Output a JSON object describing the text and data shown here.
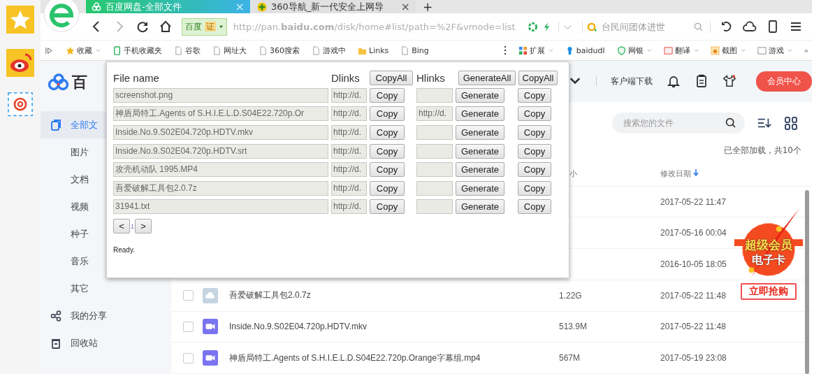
{
  "browser": {
    "tabs": [
      {
        "title": "百度网盘-全部文件",
        "close": "×",
        "selected": true
      },
      {
        "title": "360导航_新一代安全上网导",
        "close": "×",
        "selected": false
      }
    ],
    "new_tab": "+",
    "address": {
      "badge": "百度",
      "cert": "证",
      "url": "http://pan.**baidu.com**/disk/home#list/path=%2F&vmode=list"
    },
    "search": {
      "placeholder": "台民间团体进世"
    },
    "bookmarks": [
      {
        "label": "收藏",
        "kind": "star",
        "dropdown": true
      },
      {
        "label": "手机收藏夹",
        "kind": "phone",
        "dropdown": false
      },
      {
        "label": "谷歌",
        "kind": "page",
        "dropdown": false
      },
      {
        "label": "网址大",
        "kind": "page",
        "dropdown": false
      },
      {
        "label": "360搜索",
        "kind": "page",
        "dropdown": false
      },
      {
        "label": "游戏中",
        "kind": "page",
        "dropdown": false
      },
      {
        "label": "Links",
        "kind": "folder",
        "dropdown": false
      },
      {
        "label": "Bing",
        "kind": "page",
        "dropdown": false
      }
    ],
    "extensions": [
      {
        "label": "扩展",
        "kind": "apps",
        "dropdown": true
      },
      {
        "label": "baidudl",
        "kind": "pin",
        "dropdown": false
      },
      {
        "label": "网银",
        "kind": "shield",
        "dropdown": true
      },
      {
        "label": "翻译",
        "kind": "translate",
        "dropdown": true
      },
      {
        "label": "截图",
        "kind": "crop",
        "dropdown": true
      },
      {
        "label": "游戏",
        "kind": "game",
        "dropdown": true
      }
    ],
    "more": "»"
  },
  "pan": {
    "logo": "百",
    "nav": [
      {
        "label": "全部文",
        "kind": "files",
        "selected": true
      },
      {
        "label": "图片",
        "kind": "sub",
        "selected": false
      },
      {
        "label": "文档",
        "kind": "sub",
        "selected": false
      },
      {
        "label": "视频",
        "kind": "sub",
        "selected": false
      },
      {
        "label": "种子",
        "kind": "sub",
        "selected": false
      },
      {
        "label": "音乐",
        "kind": "sub",
        "selected": false
      },
      {
        "label": "其它",
        "kind": "sub",
        "selected": false
      },
      {
        "label": "我的分享",
        "kind": "share",
        "selected": false
      },
      {
        "label": "回收站",
        "kind": "trash",
        "selected": false
      }
    ],
    "header": {
      "download": "客户端下载",
      "vip": "会员中心"
    },
    "search": {
      "placeholder": "搜索您的文件"
    },
    "loaded": "已全部加载，共10个",
    "columns": {
      "size": "小",
      "date": "修改日期"
    },
    "rows": [
      {
        "date": "2017-05-22 11:47"
      },
      {
        "date": "2017-05-16 00:04"
      },
      {
        "date": "2016-10-05 18:05"
      },
      {
        "name": "吾爱破解工具包2.0.7z",
        "kind": "archive",
        "size": "1.22G",
        "date": "2017-05-22 11:48",
        "checked": false
      },
      {
        "name": "Inside.No.9.S02E04.720p.HDTV.mkv",
        "kind": "video",
        "size": "513.9M",
        "date": "2017-05-22 11:48",
        "checked": false
      },
      {
        "name": "神盾局特工.Agents of S.H.I.E.L.D.S04E22.720p.Orange字幕组.mp4",
        "kind": "video",
        "size": "567M",
        "date": "2017-05-19 23:08",
        "checked": false
      }
    ],
    "promo": {
      "title": "超级会员",
      "subtitle": "电子卡",
      "button": "立即抢购"
    }
  },
  "popup": {
    "headers": {
      "file": "File name",
      "dlinks": "Dlinks",
      "copy_all_d": "CopyAll",
      "hlinks": "Hlinks",
      "generate_all": "GenerateAll",
      "copy_all_h": "CopyAll"
    },
    "rows": [
      {
        "file": "screenshot.png",
        "dlink": "http://d.",
        "copy": "Copy",
        "generate": "Generate",
        "copy_h": "Copy"
      },
      {
        "file": "神盾局特工.Agents of S.H.I.E.L.D.S04E22.720p.Or",
        "dlink": "http://d.",
        "hlink": "http://d.",
        "copy": "Copy",
        "generate": "Generate",
        "copy_h": "Copy"
      },
      {
        "file": "Inside.No.9.S02E04.720p.HDTV.mkv",
        "dlink": "http://d.",
        "copy": "Copy",
        "generate": "Generate",
        "copy_h": "Copy"
      },
      {
        "file": "Inside.No.9.S02E04.720p.HDTV.srt",
        "dlink": "http://d.",
        "copy": "Copy",
        "generate": "Generate",
        "copy_h": "Copy"
      },
      {
        "file": "攻壳机动队 1995.MP4",
        "dlink": "http://d.",
        "copy": "Copy",
        "generate": "Generate",
        "copy_h": "Copy"
      },
      {
        "file": "吾爱破解工具包2.0.7z",
        "dlink": "http://d.",
        "copy": "Copy",
        "generate": "Generate",
        "copy_h": "Copy"
      },
      {
        "file": "31941.txt",
        "dlink": "http://d.",
        "copy": "Copy",
        "generate": "Generate",
        "copy_h": "Copy"
      }
    ],
    "pager": {
      "prev": "<",
      "page": "1",
      "next": ">"
    },
    "status": "Ready."
  }
}
